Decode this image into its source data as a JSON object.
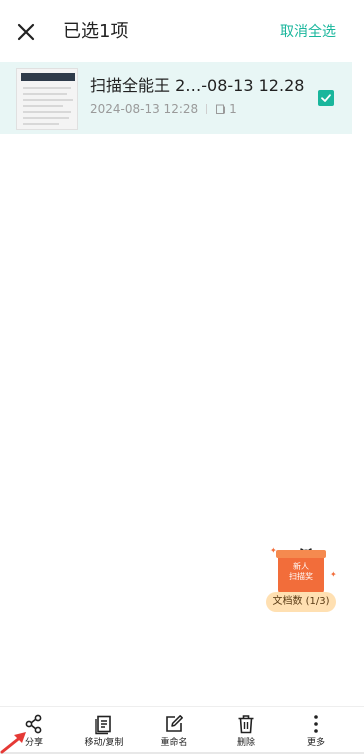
{
  "header": {
    "title": "已选1项",
    "deselect_all": "取消全选"
  },
  "document": {
    "name": "扫描全能王 2…-08-13 12.28",
    "date": "2024-08-13 12:28",
    "pages": "1",
    "selected": true
  },
  "promo": {
    "box_text": "新人\n扫描奖",
    "label": "文档数 (1/3)"
  },
  "toolbar": {
    "items": [
      {
        "label": "分享",
        "icon": "share-icon"
      },
      {
        "label": "移动/复制",
        "icon": "move-copy-icon"
      },
      {
        "label": "重命名",
        "icon": "rename-icon"
      },
      {
        "label": "删除",
        "icon": "delete-icon"
      },
      {
        "label": "更多",
        "icon": "more-icon"
      }
    ]
  },
  "colors": {
    "accent": "#19b69c",
    "selected_row_bg": "#e8f6f5",
    "promo_orange": "#f26d3a",
    "annotation_arrow": "#e53935"
  }
}
